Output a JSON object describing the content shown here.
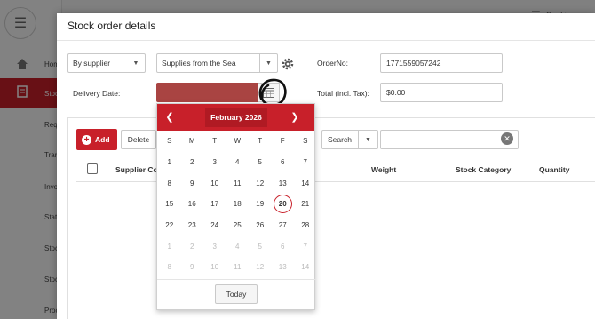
{
  "background": {
    "top_right_label": "Cookin",
    "nav_items": [
      "Home",
      "Stock",
      "Requ",
      "Tran",
      "Invo",
      "Stat",
      "Stoc",
      "Stoc",
      "Proc"
    ]
  },
  "modal": {
    "title": "Stock order details",
    "filter_by": "By supplier",
    "supplier": "Supplies from the Sea",
    "delivery_date_label": "Delivery Date:",
    "order_no_label": "OrderNo:",
    "order_no_value": "1771559057242",
    "total_label": "Total (incl. Tax):",
    "total_value": "$0.00"
  },
  "toolbar": {
    "add_label": "Add",
    "delete_label": "Delete",
    "search_label": "Search"
  },
  "grid": {
    "columns": [
      "Supplier Cod",
      "Weight",
      "Stock Category",
      "Quantity"
    ]
  },
  "calendar": {
    "month_label": "February 2026",
    "weekdays": [
      "S",
      "M",
      "T",
      "W",
      "T",
      "F",
      "S"
    ],
    "weeks": [
      [
        "1",
        "2",
        "3",
        "4",
        "5",
        "6",
        "7"
      ],
      [
        "8",
        "9",
        "10",
        "11",
        "12",
        "13",
        "14"
      ],
      [
        "15",
        "16",
        "17",
        "18",
        "19",
        "20",
        "21"
      ],
      [
        "22",
        "23",
        "24",
        "25",
        "26",
        "27",
        "28"
      ],
      [
        "1",
        "2",
        "3",
        "4",
        "5",
        "6",
        "7"
      ],
      [
        "8",
        "9",
        "10",
        "11",
        "12",
        "13",
        "14"
      ]
    ],
    "selected_day": "20",
    "today_label": "Today"
  },
  "colors": {
    "accent": "#c8202a",
    "date_field": "#a94442"
  }
}
